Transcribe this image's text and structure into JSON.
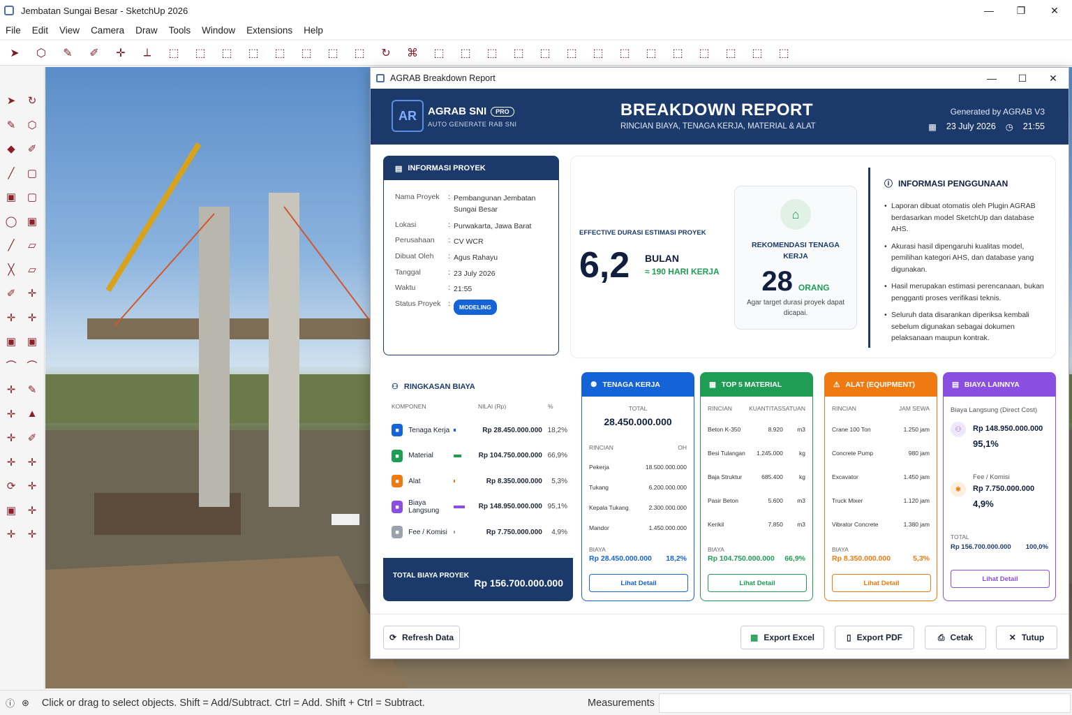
{
  "window": {
    "title": "Jembatan Sungai Besar - SketchUp 2026",
    "minimize": "—",
    "restore": "❐",
    "close": "✕"
  },
  "menu": [
    "File",
    "Edit",
    "View",
    "Camera",
    "Draw",
    "Tools",
    "Window",
    "Extensions",
    "Help"
  ],
  "toolbar_icons": [
    "select-icon",
    "eraser-shape-icon",
    "pencil-icon",
    "paint-icon",
    "move-icon",
    "axes-icon",
    "box-icon",
    "box-icon",
    "box-icon",
    "box-icon",
    "box-icon",
    "box-icon",
    "box-icon",
    "box-icon",
    "rotate-icon",
    "network-icon",
    "box-icon",
    "box-icon",
    "box-icon",
    "box-icon",
    "box-icon",
    "box-icon",
    "box-icon",
    "box-icon",
    "box-icon",
    "box-icon",
    "box-icon",
    "box-icon",
    "box-icon",
    "box-icon"
  ],
  "status": {
    "text": "Click or drag to select objects. Shift = Add/Subtract. Ctrl = Add. Shift + Ctrl = Subtract.",
    "measurements_label": "Measurements"
  },
  "dialog": {
    "title": "AGRAB Breakdown Report",
    "brand": "AGRAB SNI",
    "pro": "PRO",
    "brand_sub": "AUTO GENERATE RAB SNI",
    "report_title": "BREAKDOWN REPORT",
    "report_sub": "RINCIAN BIAYA, TENAGA KERJA, MATERIAL & ALAT",
    "generated_by": "Generated by AGRAB V3",
    "date": "23 July 2026",
    "time": "21:55"
  },
  "info": {
    "header": "INFORMASI PROYEK",
    "rows": [
      {
        "k": "Nama Proyek",
        "v": "Pembangunan Jembatan Sungai Besar"
      },
      {
        "k": "Lokasi",
        "v": "Purwakarta, Jawa Barat"
      },
      {
        "k": "Perusahaan",
        "v": "CV WCR"
      },
      {
        "k": "Dibuat Oleh",
        "v": "Agus Rahayu"
      },
      {
        "k": "Tanggal",
        "v": "23 July 2026"
      },
      {
        "k": "Waktu",
        "v": "21:55"
      }
    ],
    "status_label": "Status Proyek",
    "status_value": "MODELING"
  },
  "duration": {
    "label": "EFFECTIVE DURASI ESTIMASI PROYEK",
    "value": "6,2",
    "unit": "BULAN",
    "days": "≈ 190 HARI KERJA"
  },
  "recommend": {
    "title": "REKOMENDASI TENAGA KERJA",
    "value": "28",
    "unit": "ORANG",
    "note": "Agar target durasi proyek dapat dicapai."
  },
  "guide": {
    "title": "INFORMASI PENGGUNAAN",
    "items": [
      "Laporan dibuat otomatis oleh Plugin AGRAB berdasarkan model SketchUp dan database AHS.",
      "Akurasi hasil dipengaruhi kualitas model, pemilihan kategori AHS, dan database yang digunakan.",
      "Hasil merupakan estimasi perencanaan, bukan pengganti proses verifikasi teknis.",
      "Seluruh data disarankan diperiksa kembali sebelum digunakan sebagai dokumen pelaksanaan maupun kontrak."
    ]
  },
  "summary": {
    "title": "RINGKASAN BIAYA",
    "col_component": "KOMPONEN",
    "col_value": "NILAI (Rp)",
    "col_pct": "%",
    "rows": [
      {
        "name": "Tenaga Kerja",
        "value": "Rp 28.450.000.000",
        "pct": "18,2%",
        "fraction": 0.182,
        "color": "#1464d8"
      },
      {
        "name": "Material",
        "value": "Rp 104.750.000.000",
        "pct": "66,9%",
        "fraction": 0.669,
        "color": "#1f9d55"
      },
      {
        "name": "Alat",
        "value": "Rp 8.350.000.000",
        "pct": "5,3%",
        "fraction": 0.053,
        "color": "#f07a12"
      },
      {
        "name": "Biaya Langsung",
        "value": "Rp 148.950.000.000",
        "pct": "95,1%",
        "fraction": 0.951,
        "color": "#8a4fe0"
      },
      {
        "name": "Fee / Komisi",
        "value": "Rp 7.750.000.000",
        "pct": "4,9%",
        "fraction": 0.049,
        "color": "#9aa3ad"
      }
    ],
    "total_label": "TOTAL BIAYA PROYEK",
    "total_value": "Rp 156.700.000.000"
  },
  "labor": {
    "header": "TENAGA KERJA",
    "total_label": "TOTAL",
    "total_value": "28.450.000.000",
    "col_a": "RINCIAN",
    "col_b": "OH",
    "rows": [
      {
        "a": "Pekerja",
        "b": "18.500.000.000"
      },
      {
        "a": "Tukang",
        "b": "6.200.000.000"
      },
      {
        "a": "Kepala Tukang",
        "b": "2.300.000.000"
      },
      {
        "a": "Mandor",
        "b": "1.450.000.000"
      }
    ],
    "cost_label": "BIAYA",
    "cost_value": "Rp 28.450.000.000",
    "cost_pct": "18,2%",
    "button": "Lihat Detail"
  },
  "material": {
    "header": "TOP 5 MATERIAL",
    "col_a": "RINCIAN",
    "col_b": "KUANTITAS",
    "col_c": "SATUAN",
    "rows": [
      {
        "a": "Beton K-350",
        "b": "8.920",
        "c": "m3"
      },
      {
        "a": "Besi Tulangan",
        "b": "1.245.000",
        "c": "kg"
      },
      {
        "a": "Baja Struktur",
        "b": "685.400",
        "c": "kg"
      },
      {
        "a": "Pasir Beton",
        "b": "5.600",
        "c": "m3"
      },
      {
        "a": "Kerikil",
        "b": "7.850",
        "c": "m3"
      }
    ],
    "cost_label": "BIAYA",
    "cost_value": "Rp 104.750.000.000",
    "cost_pct": "66,9%",
    "button": "Lihat Detail"
  },
  "equipment": {
    "header": "ALAT (EQUIPMENT)",
    "col_a": "RINCIAN",
    "col_b": "JAM SEWA",
    "rows": [
      {
        "a": "Crane 100 Ton",
        "b": "1.250 jam"
      },
      {
        "a": "Concrete Pump",
        "b": "980 jam"
      },
      {
        "a": "Excavator",
        "b": "1.450 jam"
      },
      {
        "a": "Truck Mixer",
        "b": "1.120 jam"
      },
      {
        "a": "Vibrator Concrete",
        "b": "1.380 jam"
      }
    ],
    "cost_label": "BIAYA",
    "cost_value": "Rp 8.350.000.000",
    "cost_pct": "5,3%",
    "button": "Lihat Detail"
  },
  "other": {
    "header": "BIAYA LAINNYA",
    "direct_label": "Biaya Langsung (Direct Cost)",
    "direct_value": "Rp 148.950.000.000",
    "direct_pct": "95,1%",
    "fee_label": "Fee / Komisi",
    "fee_value": "Rp 7.750.000.000",
    "fee_pct": "4,9%",
    "total_label": "TOTAL",
    "total_value": "Rp 156.700.000.000",
    "total_pct": "100,0%",
    "button": "Lihat Detail"
  },
  "footer": {
    "refresh": "Refresh Data",
    "excel": "Export Excel",
    "pdf": "Export PDF",
    "print": "Cetak",
    "close": "Tutup"
  }
}
